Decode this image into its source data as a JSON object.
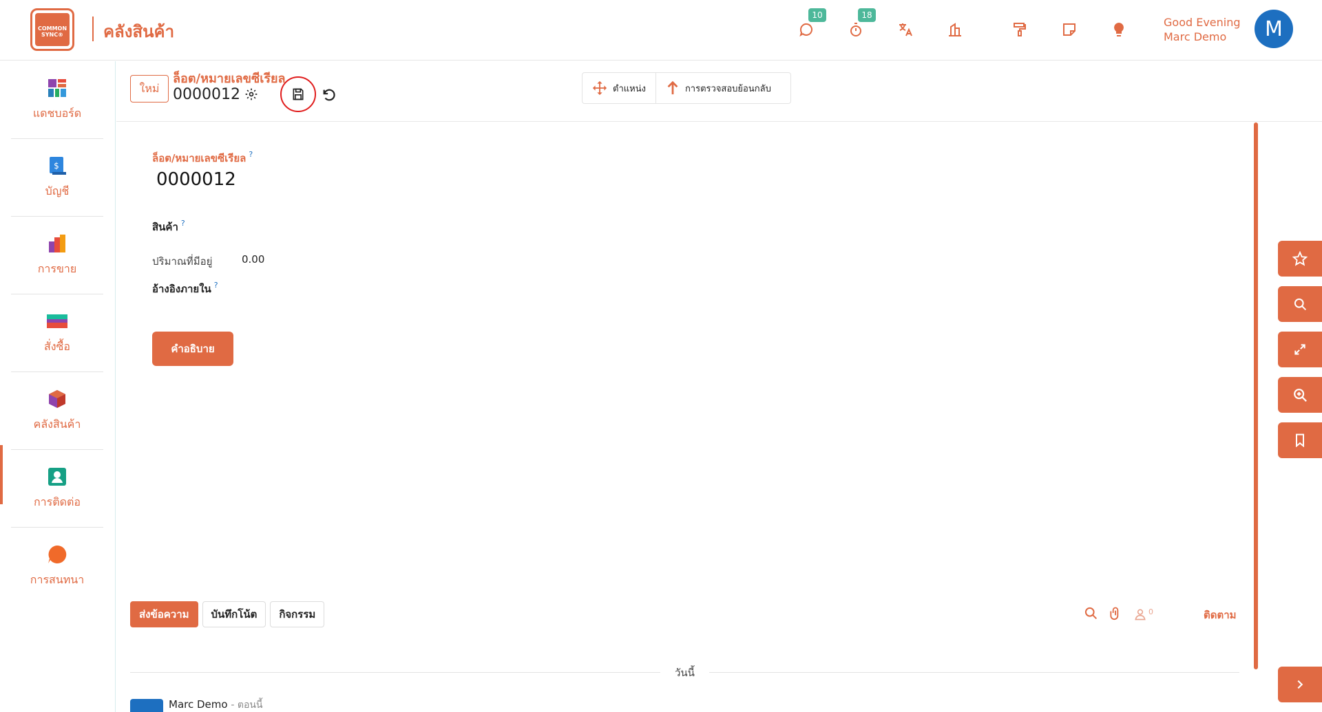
{
  "app": {
    "logo_text": "COMMON SYNC®",
    "title": "คลังสินค้า"
  },
  "topbar": {
    "messages_badge": "10",
    "activities_badge": "18",
    "greeting": "Good Evening",
    "user_name": "Marc Demo",
    "avatar_letter": "M"
  },
  "sidebar": {
    "items": [
      {
        "label": "แดชบอร์ด",
        "icon": "dashboard-icon"
      },
      {
        "label": "บัญชี",
        "icon": "accounting-icon"
      },
      {
        "label": "การขาย",
        "icon": "sales-icon"
      },
      {
        "label": "สั่งซื้อ",
        "icon": "purchase-icon"
      },
      {
        "label": "คลังสินค้า",
        "icon": "inventory-icon"
      },
      {
        "label": "การติดต่อ",
        "icon": "contacts-icon"
      },
      {
        "label": "การสนทนา",
        "icon": "discuss-icon"
      }
    ],
    "active_index": 4
  },
  "control": {
    "new_label": "ใหม่",
    "breadcrumb_parent": "ล็อต/หมายเลขซีเรียล",
    "breadcrumb_current": "0000012",
    "smart_buttons": [
      {
        "label": "ตำแหน่ง",
        "icon": "move-arrows-icon"
      },
      {
        "label": "การตรวจสอบย้อนกลับ",
        "icon": "arrow-up-icon"
      }
    ]
  },
  "form": {
    "lot_label": "ล็อต/หมายเลขซีเรียล",
    "lot_value": "0000012",
    "product_label": "สินค้า",
    "qty_label": "ปริมาณที่มีอยู่",
    "qty_value": "0.00",
    "ref_label": "อ้างอิงภายใน",
    "help_mark": "?",
    "description_button": "คำอธิบาย"
  },
  "chatter": {
    "send_message": "ส่งข้อความ",
    "log_note": "บันทึกโน้ต",
    "activity": "กิจกรรม",
    "followers_count": "0",
    "follow_label": "ติดตาม",
    "today_label": "วันนี้",
    "message_author": "Marc Demo",
    "message_time": "- ตอนนี้"
  },
  "colors": {
    "accent": "#e06a43",
    "badge": "#4db89a",
    "avatar": "#1d6fc0",
    "save_highlight": "#e01b1b"
  }
}
